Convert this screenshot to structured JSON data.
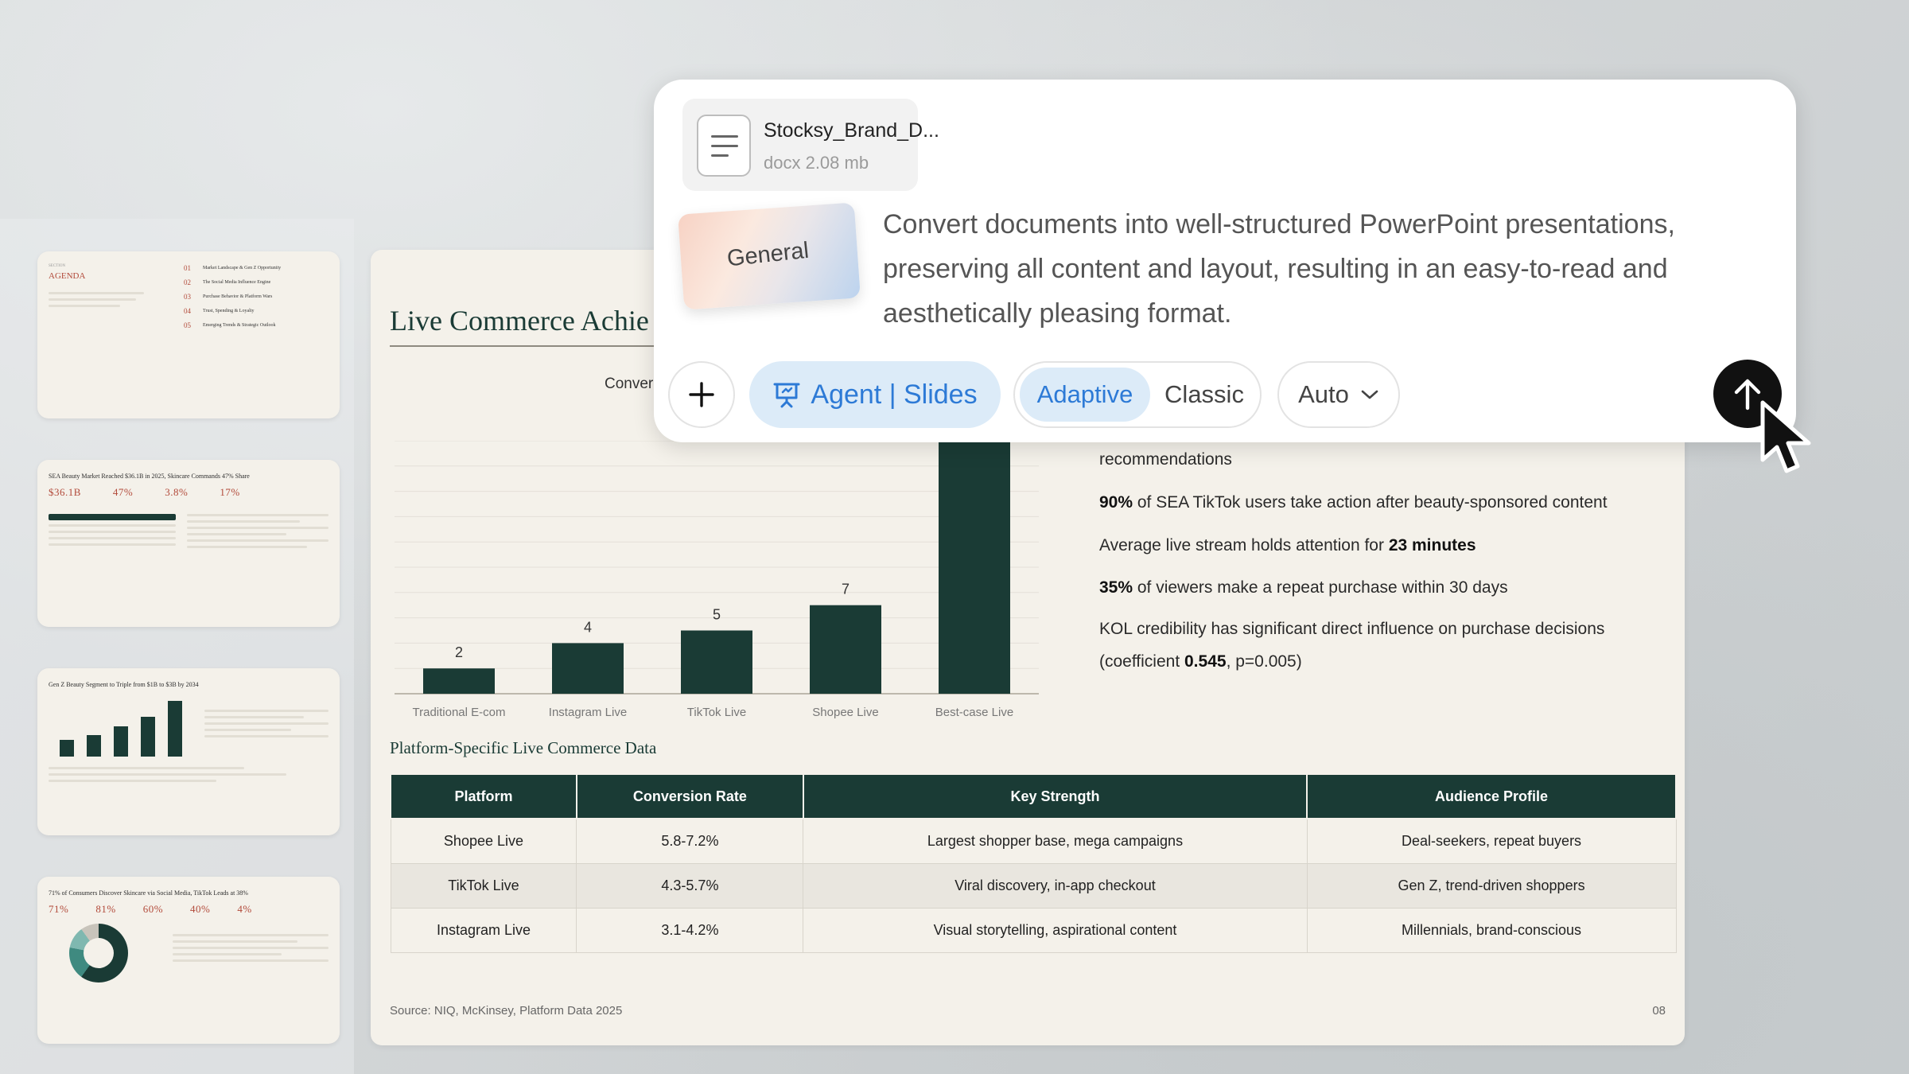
{
  "prompt_card": {
    "file": {
      "name": "Stocksy_Brand_D...",
      "meta": "docx 2.08 mb",
      "icon": "document-icon"
    },
    "template_label": "General",
    "description": "Convert documents into well-structured PowerPoint presentations, preserving all content and layout, resulting in an easy-to-read and aesthetically pleasing format.",
    "agent_label": "Agent | Slides",
    "modes": {
      "selected": "Adaptive",
      "adaptive": "Adaptive",
      "classic": "Classic"
    },
    "auto_label": "Auto",
    "accent": "#2d7ad6"
  },
  "slide": {
    "title": "Live Commerce Achie",
    "chart_subtitle": "Conver",
    "bullets": {
      "b1": "recommendations",
      "b2_bold": "90%",
      "b2_rest": " of SEA TikTok users take action after beauty-sponsored content",
      "b3_pre": "Average live stream holds attention for ",
      "b3_bold": "23 minutes",
      "b4_bold": "35%",
      "b4_rest": " of viewers make a repeat purchase within 30 days",
      "b5_pre": "KOL credibility has significant direct influence on purchase decisions (coefficient ",
      "b5_bold": "0.545",
      "b5_post": ", p=0.005)"
    },
    "table_title": "Platform-Specific Live Commerce Data",
    "table": {
      "headers": [
        "Platform",
        "Conversion Rate",
        "Key Strength",
        "Audience Profile"
      ],
      "rows": [
        [
          "Shopee Live",
          "5.8-7.2%",
          "Largest shopper base, mega campaigns",
          "Deal-seekers, repeat buyers"
        ],
        [
          "TikTok Live",
          "4.3-5.7%",
          "Viral discovery, in-app checkout",
          "Gen Z, trend-driven shoppers"
        ],
        [
          "Instagram Live",
          "3.1-4.2%",
          "Visual storytelling, aspirational content",
          "Millennials, brand-conscious"
        ]
      ]
    },
    "source": "Source: NIQ, McKinsey, Platform Data 2025",
    "page_number": "08",
    "color_dark": "#1a3b35"
  },
  "chart_data": {
    "type": "bar",
    "categories": [
      "Traditional E-com",
      "Instagram Live",
      "TikTok Live",
      "Shopee Live",
      "Best-case Live"
    ],
    "values": [
      2,
      4,
      5,
      7,
      20
    ],
    "value_labels": [
      "2",
      "4",
      "5",
      "7",
      ""
    ],
    "ylim": [
      0,
      20
    ],
    "grid": true,
    "color": "#1a3b35"
  },
  "thumbnails": {
    "t1": {
      "kicker": "SECTION",
      "title": "AGENDA",
      "items": [
        {
          "num": "01",
          "text": "Market Landscape & Gen Z Opportunity"
        },
        {
          "num": "02",
          "text": "The Social Media Influence Engine"
        },
        {
          "num": "03",
          "text": "Purchase Behavior & Platform Wars"
        },
        {
          "num": "04",
          "text": "Trust, Spending & Loyalty"
        },
        {
          "num": "05",
          "text": "Emerging Trends & Strategic Outlook"
        }
      ]
    },
    "t2": {
      "title": "SEA Beauty Market Reached $36.1B in 2025, Skincare Commands 47% Share",
      "stats": [
        "$36.1B",
        "47%",
        "3.8%",
        "17%"
      ]
    },
    "t3": {
      "title": "Gen Z Beauty Segment to Triple from $1B to $3B by 2034",
      "bars": [
        0.3,
        0.38,
        0.55,
        0.72,
        1.0
      ]
    },
    "t4": {
      "title": "71% of Consumers Discover Skincare via Social Media, TikTok Leads at 38%",
      "stats": [
        "71%",
        "81%",
        "60%",
        "40%",
        "4%"
      ]
    }
  }
}
